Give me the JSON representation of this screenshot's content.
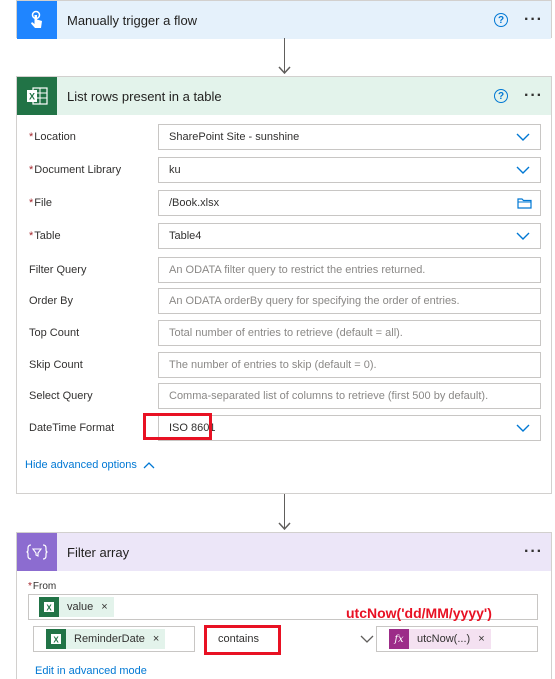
{
  "trigger": {
    "title": "Manually trigger a flow"
  },
  "list_rows": {
    "title": "List rows present in a table",
    "fields": [
      {
        "label": "Location",
        "required": true,
        "value": "SharePoint Site - sunshine",
        "placeholder": "",
        "control": "dropdown"
      },
      {
        "label": "Document Library",
        "required": true,
        "value": "ku",
        "placeholder": "",
        "control": "dropdown"
      },
      {
        "label": "File",
        "required": true,
        "value": "/Book.xlsx",
        "placeholder": "",
        "control": "file"
      },
      {
        "label": "Table",
        "required": true,
        "value": "Table4",
        "placeholder": "",
        "control": "dropdown"
      },
      {
        "label": "Filter Query",
        "required": false,
        "value": "",
        "placeholder": "An ODATA filter query to restrict the entries returned.",
        "control": "text"
      },
      {
        "label": "Order By",
        "required": false,
        "value": "",
        "placeholder": "An ODATA orderBy query for specifying the order of entries.",
        "control": "text"
      },
      {
        "label": "Top Count",
        "required": false,
        "value": "",
        "placeholder": "Total number of entries to retrieve (default = all).",
        "control": "text"
      },
      {
        "label": "Skip Count",
        "required": false,
        "value": "",
        "placeholder": "The number of entries to skip (default = 0).",
        "control": "text"
      },
      {
        "label": "Select Query",
        "required": false,
        "value": "",
        "placeholder": "Comma-separated list of columns to retrieve (first 500 by default).",
        "control": "text"
      },
      {
        "label": "DateTime Format",
        "required": false,
        "value": "ISO 8601",
        "placeholder": "",
        "control": "dropdown"
      }
    ],
    "hide_advanced": "Hide advanced options"
  },
  "filter_array": {
    "title": "Filter array",
    "from_label": "From",
    "from_token": "value",
    "condition_left_token": "ReminderDate",
    "condition_operator": "contains",
    "condition_right_token": "utcNow(...)",
    "edit_advanced": "Edit in advanced mode"
  },
  "annotation": "utcNow('dd/MM/yyyy')",
  "colors": {
    "highlight": "#e81123",
    "link": "#0078d4",
    "excel": "#217346",
    "trigger": "#1f85ff",
    "filter": "#8c6cd0"
  }
}
